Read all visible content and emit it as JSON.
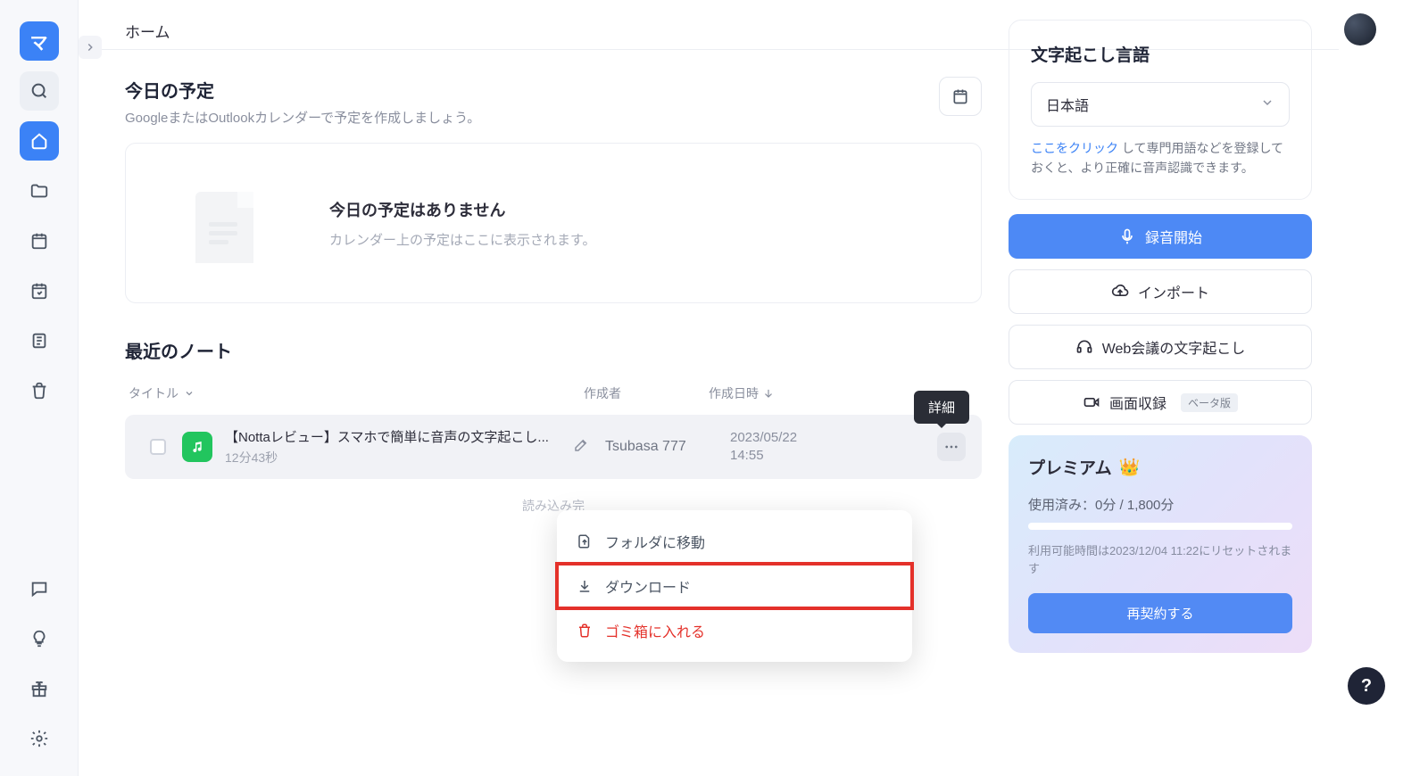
{
  "header": {
    "title": "ホーム"
  },
  "schedule": {
    "title": "今日の予定",
    "subtitle": "GoogleまたはOutlookカレンダーで予定を作成しましょう。",
    "empty_title": "今日の予定はありません",
    "empty_sub": "カレンダー上の予定はここに表示されます。"
  },
  "recent": {
    "title": "最近のノート",
    "columns": {
      "title": "タイトル",
      "author": "作成者",
      "date": "作成日時"
    },
    "tooltip": "詳細",
    "loading_done": "読み込み完",
    "notes": [
      {
        "title": "【Nottaレビュー】スマホで簡単に音声の文字起こし...",
        "duration": "12分43秒",
        "author": "Tsubasa 777",
        "date_line1": "2023/05/22",
        "date_line2": "14:55"
      }
    ]
  },
  "context_menu": {
    "move": "フォルダに移動",
    "download": "ダウンロード",
    "trash": "ゴミ箱に入れる"
  },
  "right": {
    "lang_title": "文字起こし言語",
    "lang_value": "日本語",
    "hint_link": "ここをクリック",
    "hint_text": " して専門用語などを登録しておくと、より正確に音声認識できます。",
    "record": "録音開始",
    "import": "インポート",
    "web_meeting": "Web会議の文字起こし",
    "screen_rec": "画面収録",
    "beta": "ベータ版"
  },
  "premium": {
    "title": "プレミアム",
    "usage": "使用済み：0分 / 1,800分",
    "reset": "利用可能時間は2023/12/04 11:22にリセットされます",
    "renew": "再契約する"
  }
}
